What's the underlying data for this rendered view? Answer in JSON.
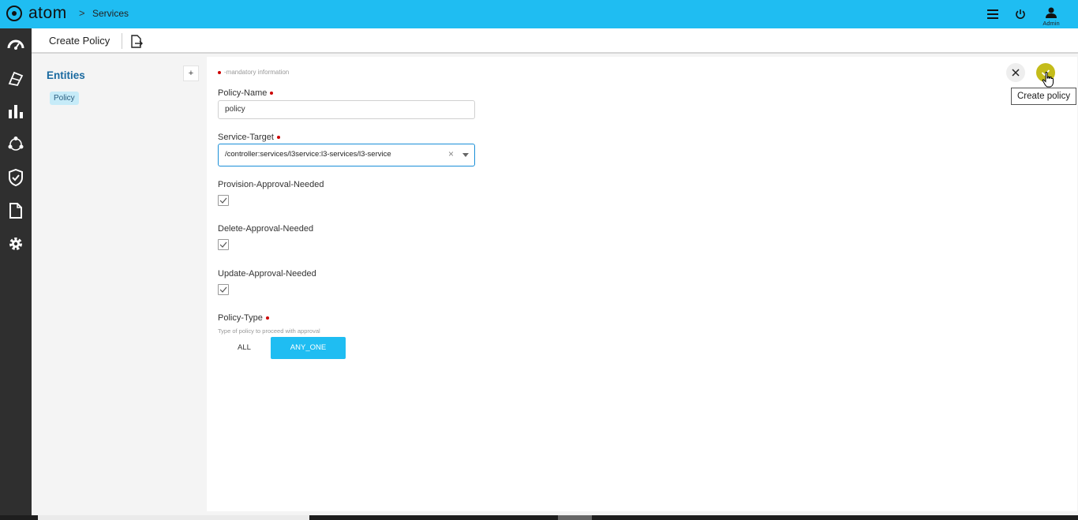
{
  "app": {
    "logo_text": "atom",
    "breadcrumb_separator": ">",
    "breadcrumb": "Services",
    "user_label": "Admin",
    "accent_color": "#1fbdf2"
  },
  "topbar_icons": [
    "list-icon",
    "power-icon",
    "user-icon"
  ],
  "leftnav": {
    "icons": [
      "dashboard-icon",
      "devices-icon",
      "chart-icon",
      "network-icon",
      "shield-icon",
      "document-icon",
      "gear-icon"
    ]
  },
  "subheader": {
    "title": "Create Policy"
  },
  "entities": {
    "title": "Entities",
    "add_label": "+",
    "items": [
      "Policy"
    ]
  },
  "form": {
    "mandatory_note": "-mandatory information",
    "policy_name": {
      "label": "Policy-Name",
      "value": "policy"
    },
    "service_target": {
      "label": "Service-Target",
      "value": "/controller:services/l3service:l3-services/l3-service",
      "clear": "×"
    },
    "provision_approval": {
      "label": "Provision-Approval-Needed",
      "checked": true
    },
    "delete_approval": {
      "label": "Delete-Approval-Needed",
      "checked": true
    },
    "update_approval": {
      "label": "Update-Approval-Needed",
      "checked": true
    },
    "policy_type": {
      "label": "Policy-Type",
      "hint": "Type of policy to proceed with approval",
      "options": [
        "ALL",
        "ANY_ONE"
      ],
      "selected": "ANY_ONE"
    }
  },
  "actions": {
    "close": "×",
    "confirm_tooltip": "Create policy"
  }
}
